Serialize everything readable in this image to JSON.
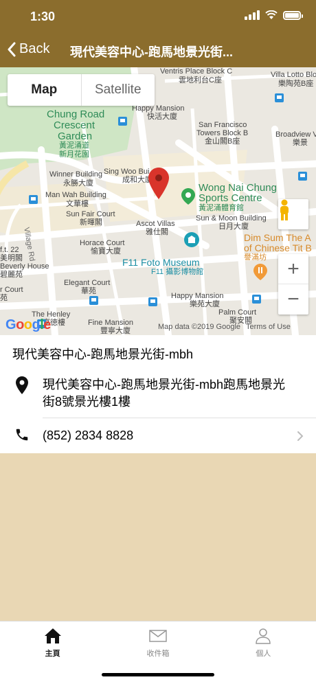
{
  "status_bar": {
    "time": "1:30"
  },
  "nav": {
    "back_label": "Back",
    "title": "現代美容中心-跑馬地景光街..."
  },
  "map": {
    "segmented": {
      "map_label": "Map",
      "satellite_label": "Satellite"
    },
    "labels": {
      "ventris": "Ventris Place Block C",
      "ventris_zh": "雲地利台C座",
      "villa_lotto": "Villa Lotto Block",
      "villa_lotto_zh": "樂陶苑B座",
      "chung_road": "Chung Road",
      "crescent": "Crescent",
      "garden": "Garden",
      "garden_zh1": "黃泥涌道",
      "garden_zh2": "新月花園",
      "happy_mansion": "Happy Mansion",
      "happy_mansion_zh": "快活大廈",
      "san_francisco": "San Francisco",
      "towers_b": "Towers Block B",
      "towers_b_zh": "金山閣B座",
      "broadview": "Broadview V",
      "broadview_zh": "樂景",
      "winner": "Winner Building",
      "winner_zh": "永勝大廈",
      "sing_woo": "Sing Woo Bui",
      "sing_woo_zh": "成和大廈",
      "man_wah": "Man Wah Building",
      "man_wah_zh": "文華樓",
      "sports_1": "Wong Nai Chung",
      "sports_2": "Sports Centre",
      "sports_zh": "黃泥涌體育館",
      "sun_fair": "Sun Fair Court",
      "sun_fair_zh": "新暉閣",
      "sun_moon": "Sun & Moon Building",
      "sun_moon_zh": "日月大廈",
      "village_rd": "Village Rd",
      "ascot": "Ascot Villas",
      "ascot_zh": "雅仕閣",
      "dim_sum_1": "Dim Sum The A",
      "dim_sum_2": "of Chinese Tit B",
      "dim_sum_zh": "譽滿坊",
      "ft22": "f.t. 22",
      "horace": "Horace Court",
      "horace_zh": "愉寶大廈",
      "f11_1": "F11 Foto Museum",
      "f11_zh": "F11 攝影博物館",
      "beverly": "Beverly House",
      "beverly_zh": "碧麗苑",
      "ming_zh": "美明閣",
      "elegant": "Elegant Court",
      "elegant_zh": "華苑",
      "court": "r Court",
      "court_zh": "苑",
      "happy_mansion2": "Happy Mansion",
      "happy_mansion2_zh": "樂苑大廈",
      "palm": "Palm Court",
      "palm_zh": "聚安閣",
      "henley": "The Henley",
      "henley_zh": "亨徳樓",
      "fine": "Fine Mansion",
      "fine_zh": "豐寧大廈",
      "google": "Google",
      "map_data": "Map data ©2019 Google",
      "terms": "Terms of Use"
    }
  },
  "info": {
    "title": "現代美容中心-跑馬地景光街-mbh",
    "address": "現代美容中心-跑馬地景光街-mbh跑馬地景光街8號景光樓1樓",
    "phone": "(852) 2834 8828"
  },
  "tabs": [
    {
      "label": "主頁",
      "icon": "home-icon"
    },
    {
      "label": "收件箱",
      "icon": "mail-icon"
    },
    {
      "label": "個人",
      "icon": "person-icon"
    }
  ],
  "colors": {
    "header": "#8b6d2d",
    "page_bg": "#e9d7b4",
    "pin": "#d9342b"
  }
}
